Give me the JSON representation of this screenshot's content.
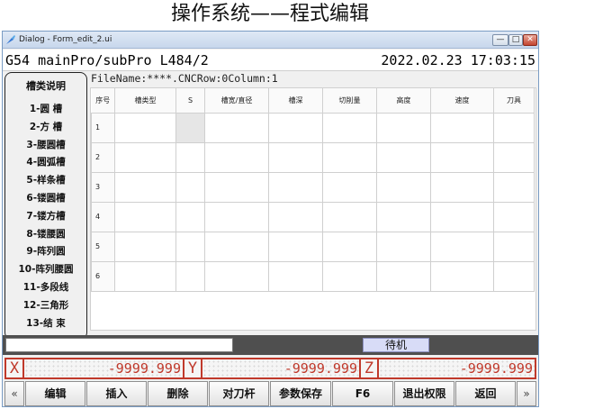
{
  "page_title": "操作系统——程式编辑",
  "window": {
    "title": "Dialog - Form_edit_2.ui",
    "minimize_label": "—",
    "maximize_label": "□",
    "close_label": "✕"
  },
  "status": {
    "program": "G54  mainPro/subPro L484/2",
    "datetime": "2022.02.23 17:03:15"
  },
  "slot_panel": {
    "title": "槽类说明",
    "items": [
      "1-圆  槽",
      "2-方  槽",
      "3-腰圆槽",
      "4-圆弧槽",
      "5-样条槽",
      "6-镂圆槽",
      "7-镂方槽",
      "8-镂腰圆",
      "9-阵列圆",
      "10-阵列腰圆",
      "11-多段线",
      "12-三角形",
      "13-结  束"
    ]
  },
  "file_info": "FileName:****.CNCRow:0Column:1",
  "table": {
    "headers": [
      "序号",
      "槽类型",
      "S",
      "槽宽/直径",
      "槽深",
      "切削量",
      "高度",
      "速度",
      "刀具"
    ],
    "rows": [
      "1",
      "2",
      "3",
      "4",
      "5",
      "6"
    ]
  },
  "command_input": {
    "value": ""
  },
  "machine_state": "待机",
  "coords": {
    "x_label": "X",
    "x_value": "-9999.999",
    "y_label": "Y",
    "y_value": "-9999.999",
    "z_label": "Z",
    "z_value": "-9999.999"
  },
  "softkeys": {
    "prev": "«",
    "edit": "编辑",
    "insert": "插入",
    "delete": "删除",
    "tool_setting": "对刀杆",
    "save_params": "参数保存",
    "f6": "F6",
    "exit_permission": "退出权限",
    "back": "返回",
    "next": "»"
  },
  "colors": {
    "coord_accent": "#c0392b",
    "state_bg": "#d8dcf7",
    "input_bar_bg": "#4f4f4f"
  }
}
